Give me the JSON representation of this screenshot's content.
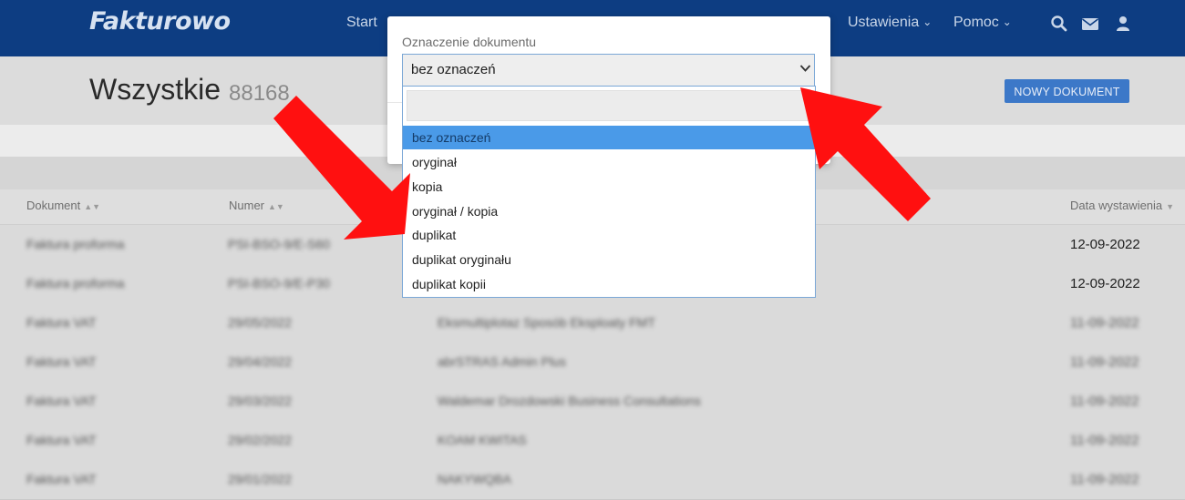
{
  "app": {
    "logo": "Fakturowo"
  },
  "nav": {
    "start": "Start",
    "settings": "Ustawienia",
    "help": "Pomoc",
    "icons": [
      "search-icon",
      "envelope-icon",
      "user-icon"
    ]
  },
  "page": {
    "title": "Wszystkie",
    "count": "88168",
    "new_button": "NOWY DOKUMENT"
  },
  "table": {
    "headers": {
      "document": "Dokument",
      "number": "Numer",
      "date": "Data wystawienia"
    },
    "rows": [
      {
        "document": "Faktura proforma",
        "number": "PSI-BSO-9/E-S60",
        "client": "",
        "date": "12-09-2022"
      },
      {
        "document": "Faktura proforma",
        "number": "PSI-BSO-9/E-P30",
        "client": "",
        "date": "12-09-2022"
      },
      {
        "document": "Faktura VAT",
        "number": "29/05/2022",
        "client": "Eksmultiplotaz Sposób Eksploaty FMT",
        "date": "11-09-2022"
      },
      {
        "document": "Faktura VAT",
        "number": "29/04/2022",
        "client": "abrSTRAS Admin Plus",
        "date": "11-09-2022"
      },
      {
        "document": "Faktura VAT",
        "number": "29/03/2022",
        "client": "Waldemar Drozdowski Business Consultations",
        "date": "11-09-2022"
      },
      {
        "document": "Faktura VAT",
        "number": "29/02/2022",
        "client": "KOAM KWITAS",
        "date": "11-09-2022"
      },
      {
        "document": "Faktura VAT",
        "number": "29/01/2022",
        "client": "NAKYWQBA",
        "date": "11-09-2022"
      }
    ]
  },
  "modal": {
    "label": "Oznaczenie dokumentu",
    "selected": "bez oznaczeń",
    "search_value": "",
    "options": [
      "bez oznaczeń",
      "oryginał",
      "kopia",
      "oryginał / kopia",
      "duplikat",
      "duplikat oryginału",
      "duplikat kopii"
    ]
  },
  "colors": {
    "topbar": "#0d3d82",
    "accent_button": "#3c78c8",
    "selected_option": "#4a9ae8",
    "arrow": "#ff0000"
  }
}
